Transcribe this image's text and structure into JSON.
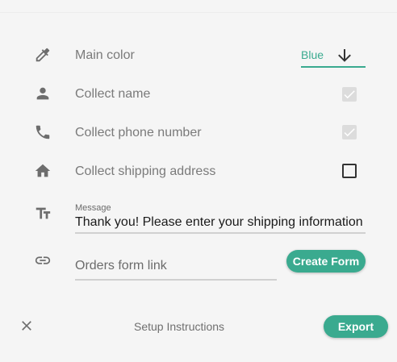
{
  "settings": {
    "main_color": {
      "label": "Main color",
      "value": "Blue",
      "icon": "eyedropper-icon"
    },
    "collect_name": {
      "label": "Collect name",
      "checked": true,
      "icon": "person-icon"
    },
    "collect_phone": {
      "label": "Collect phone number",
      "checked": true,
      "icon": "phone-icon"
    },
    "collect_shipping": {
      "label": "Collect shipping address",
      "checked": false,
      "icon": "home-icon"
    },
    "message": {
      "caption": "Message",
      "value": "Thank you! Please enter your shipping information",
      "icon": "text-size-icon"
    },
    "orders_form_link": {
      "placeholder": "Orders form link",
      "icon": "link-icon",
      "button_label": "Create Form"
    }
  },
  "footer": {
    "close_icon": "close-icon",
    "setup_label": "Setup Instructions",
    "export_label": "Export"
  },
  "colors": {
    "accent": "#3aaa8f",
    "icon": "#6d6d6d",
    "label": "#7a7a7a",
    "background": "#f5f5f5"
  }
}
